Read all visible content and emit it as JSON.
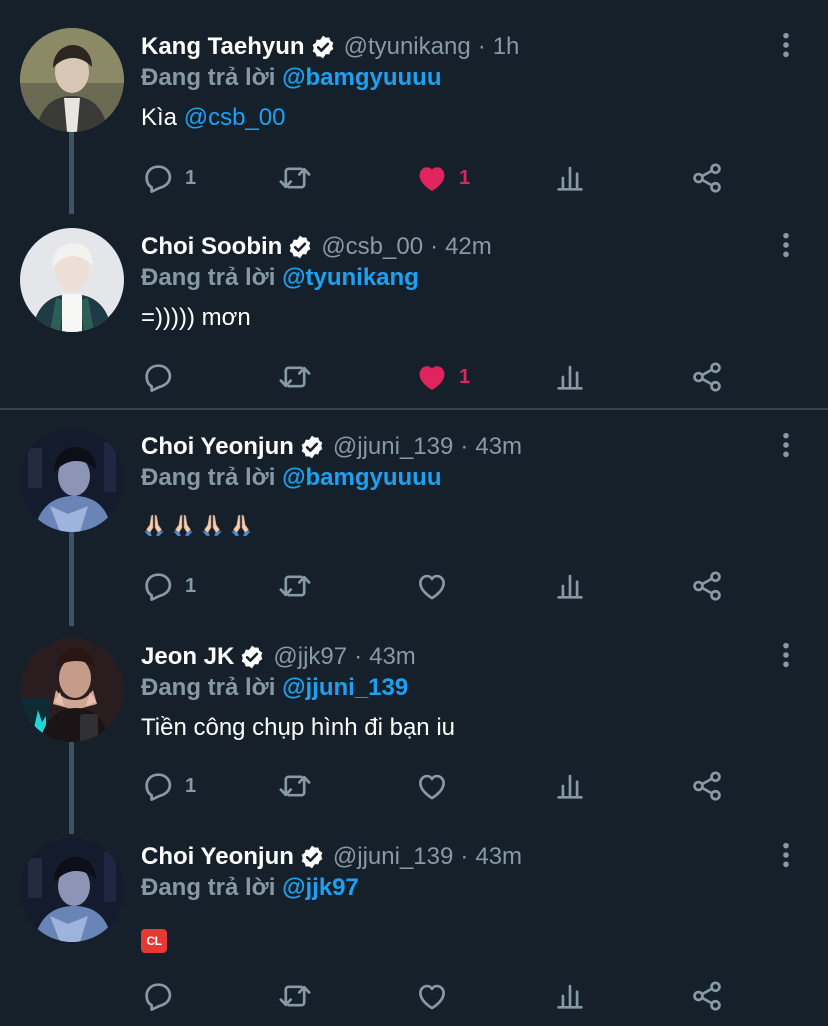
{
  "colors": {
    "background": "#15202b",
    "muted_text": "#8899a6",
    "link": "#1da1f2",
    "like_active": "#e0245e",
    "icon": "#8899a6",
    "thread_line": "#3d5466",
    "divider": "#38444d"
  },
  "icons": {
    "verified": "verified-badge-icon",
    "more": "more-vertical-icon",
    "reply": "reply-icon",
    "retweet": "retweet-icon",
    "like": "heart-icon",
    "analytics": "analytics-icon",
    "share": "share-icon"
  },
  "tweets": [
    {
      "name": "Kang Taehyun",
      "handle": "@tyunikang",
      "time": "1h",
      "reply_prefix": "Đang trả lời",
      "reply_to": "@bamgyuuuu",
      "text": "Kìa",
      "mention": "@csb_00",
      "reply_count": "1",
      "like_count": "1",
      "liked": true
    },
    {
      "name": "Choi Soobin",
      "handle": "@csb_00",
      "time": "42m",
      "reply_prefix": "Đang trả lời",
      "reply_to": "@tyunikang",
      "text": "=))))) mơn",
      "like_count": "1",
      "liked": true
    },
    {
      "name": "Choi Yeonjun",
      "handle": "@jjuni_139",
      "time": "43m",
      "reply_prefix": "Đang trả lời",
      "reply_to": "@bamgyuuuu",
      "text": "🙏🏻🙏🏻🙏🏻🙏🏻",
      "reply_count": "1",
      "liked": false
    },
    {
      "name": "Jeon JK",
      "handle": "@jjk97",
      "time": "43m",
      "reply_prefix": "Đang trả lời",
      "reply_to": "@jjuni_139",
      "text": "Tiền công chụp hình đi bạn iu",
      "reply_count": "1",
      "liked": false
    },
    {
      "name": "Choi Yeonjun",
      "handle": "@jjuni_139",
      "time": "43m",
      "reply_prefix": "Đang trả lời",
      "reply_to": "@jjk97",
      "text": "🆑",
      "liked": false
    }
  ]
}
